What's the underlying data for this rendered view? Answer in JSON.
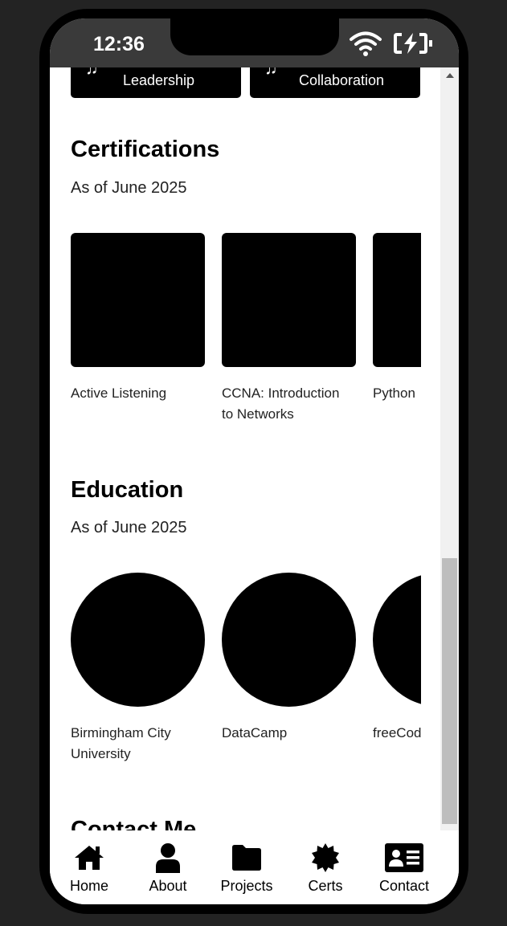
{
  "status": {
    "time": "12:36"
  },
  "skills": {
    "leadership": "Leadership",
    "collaboration": "Collaboration"
  },
  "certifications": {
    "title": "Certifications",
    "subtitle": "As of June 2025",
    "items": [
      {
        "label": "Active Listening"
      },
      {
        "label": "CCNA: Introduction\nto Networks"
      },
      {
        "label": "Python"
      }
    ]
  },
  "education": {
    "title": "Education",
    "subtitle": "As of June 2025",
    "items": [
      {
        "label": "Birmingham City\nUniversity"
      },
      {
        "label": "DataCamp"
      },
      {
        "label": "freeCodeCamp"
      }
    ]
  },
  "contact": {
    "title": "Contact Me"
  },
  "nav": {
    "home": "Home",
    "about": "About",
    "projects": "Projects",
    "certs": "Certs",
    "contact": "Contact"
  }
}
